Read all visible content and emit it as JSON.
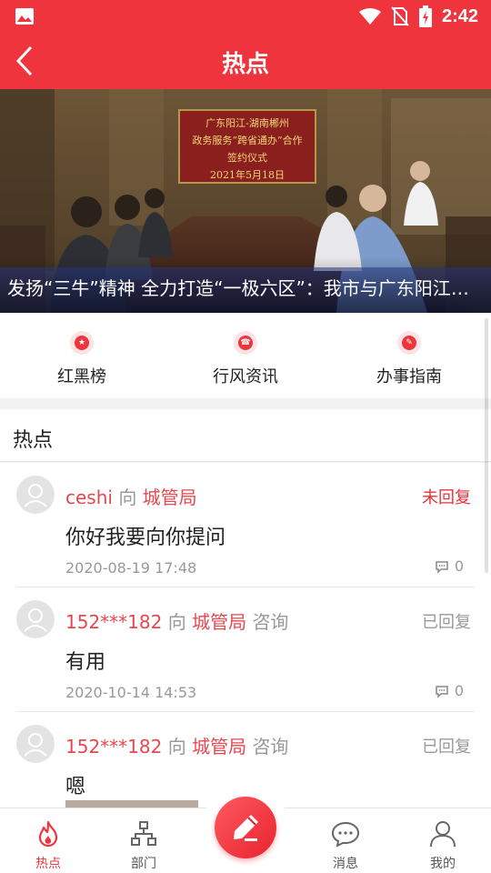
{
  "status_bar": {
    "time": "2:42"
  },
  "header": {
    "title": "热点"
  },
  "banner": {
    "caption": "发扬“三牛”精神 全力打造“一极六区”：我市与广东阳江签订政务服务“跨省通办”合作协议",
    "sign_lines": [
      "广东阳江-湖南郴州",
      "政务服务“跨省通办”合作",
      "签约仪式",
      "2021年5月18日"
    ]
  },
  "quick_nav": [
    {
      "label": "红黑榜",
      "icon": "star-badge-icon"
    },
    {
      "label": "行风资讯",
      "icon": "phone-badge-icon"
    },
    {
      "label": "办事指南",
      "icon": "guide-badge-icon"
    }
  ],
  "section": {
    "title": "热点"
  },
  "posts": [
    {
      "user": "ceshi",
      "to_word": "向",
      "department": "城管局",
      "type": "",
      "status": "未回复",
      "content": "你好我要向你提问",
      "time": "2020-08-19 17:48",
      "comments": "0"
    },
    {
      "user": "152***182",
      "to_word": "向",
      "department": "城管局",
      "type": "咨询",
      "status": "已回复",
      "content": "有用",
      "time": "2020-10-14 14:53",
      "comments": "0"
    },
    {
      "user": "152***182",
      "to_word": "向",
      "department": "城管局",
      "type": "咨询",
      "status": "已回复",
      "content": "嗯",
      "time": "",
      "comments": ""
    }
  ],
  "bottom_nav": [
    {
      "label": "热点",
      "icon": "flame-icon",
      "active": true
    },
    {
      "label": "部门",
      "icon": "org-chart-icon",
      "active": false
    },
    {
      "label": "消息",
      "icon": "chat-bubble-icon",
      "active": false
    },
    {
      "label": "我的",
      "icon": "user-icon",
      "active": false
    }
  ],
  "colors": {
    "primary": "#f0343d",
    "accent_text": "#e8474f",
    "unreplied": "#e8313a",
    "muted": "#999999"
  }
}
